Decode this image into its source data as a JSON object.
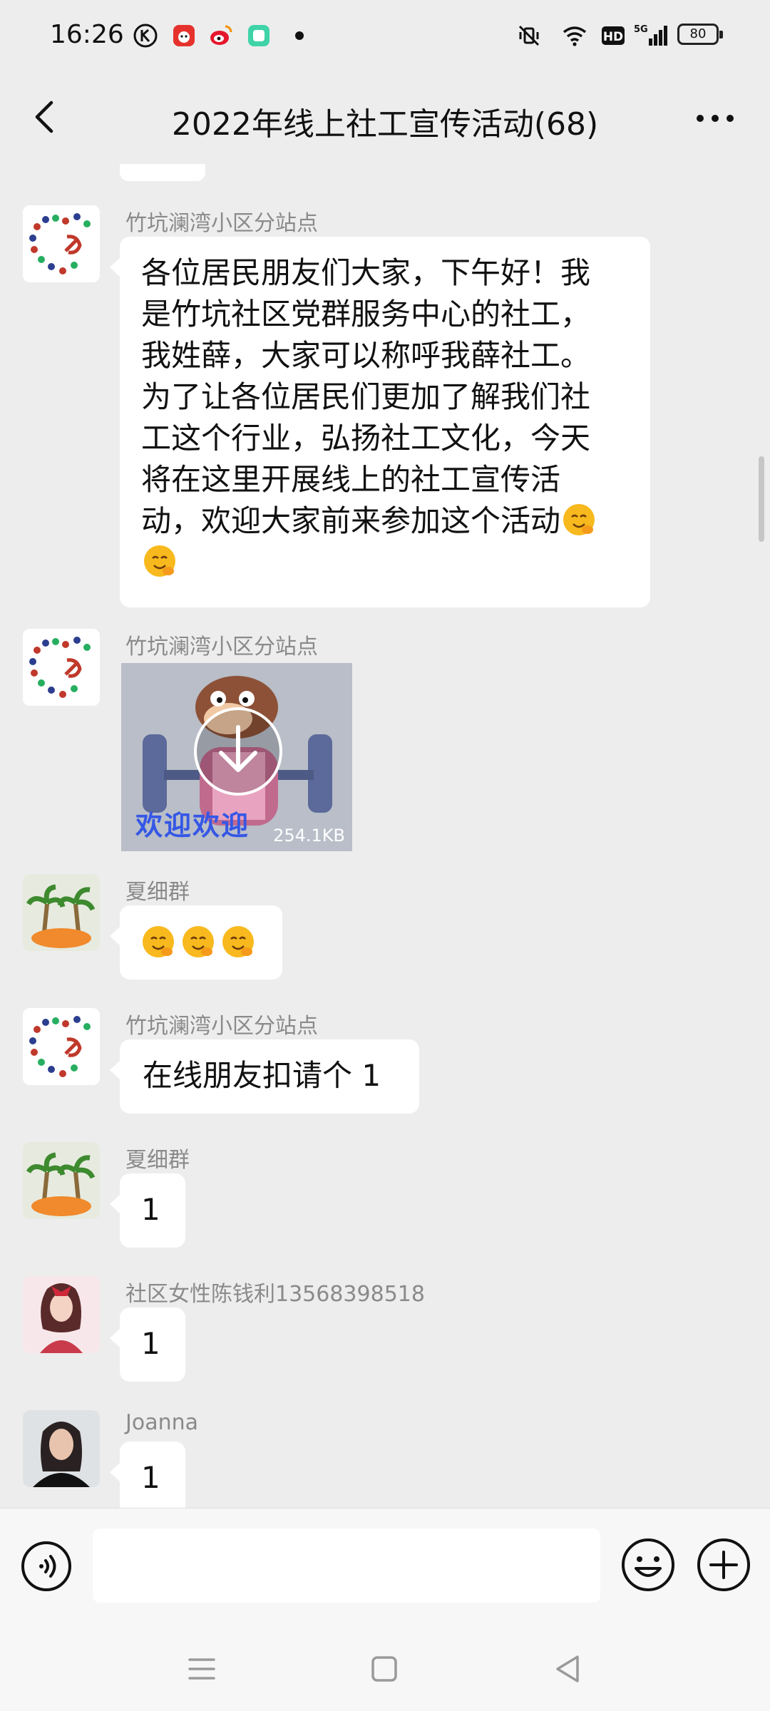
{
  "status_bar": {
    "time": "16:26",
    "network": "5G",
    "hd": "HD",
    "battery": "80"
  },
  "nav": {
    "title": "2022年线上社工宣传活动(68)",
    "back_icon": "chevron-left-icon",
    "more_icon": "more-dots-icon"
  },
  "messages": [
    {
      "sender": "竹坑澜湾小区分站点",
      "type": "text",
      "lines": [
        "各位居民朋友们大家，下午好！我",
        "是竹坑社区党群服务中心的社工，",
        "我姓薛，大家可以称呼我薛社工。",
        "为了让各位居民们更加了解我们社",
        "工这个行业，弘扬社工文化，今天",
        "将在这里开展线上的社工宣传活",
        "动，欢迎大家前来参加这个活动"
      ]
    },
    {
      "sender": "竹坑澜湾小区分站点",
      "type": "video",
      "caption": "欢迎欢迎",
      "size": "254.1KB"
    },
    {
      "sender": "夏细群",
      "type": "emoji"
    },
    {
      "sender": "竹坑澜湾小区分站点",
      "type": "text",
      "text": "在线朋友扣请个 1"
    },
    {
      "sender": "夏细群",
      "type": "text",
      "text": "1"
    },
    {
      "sender": "社区女性陈钱利13568398518",
      "type": "text",
      "text": "1"
    },
    {
      "sender": "Joanna",
      "type": "text",
      "text": "1"
    }
  ],
  "input_bar": {
    "voice_icon": "voice-icon",
    "emoji_icon": "smiley-icon",
    "plus_icon": "plus-icon"
  },
  "colors": {
    "background": "#ededed",
    "bubble": "#ffffff",
    "sender_text": "#8a8a8a"
  }
}
